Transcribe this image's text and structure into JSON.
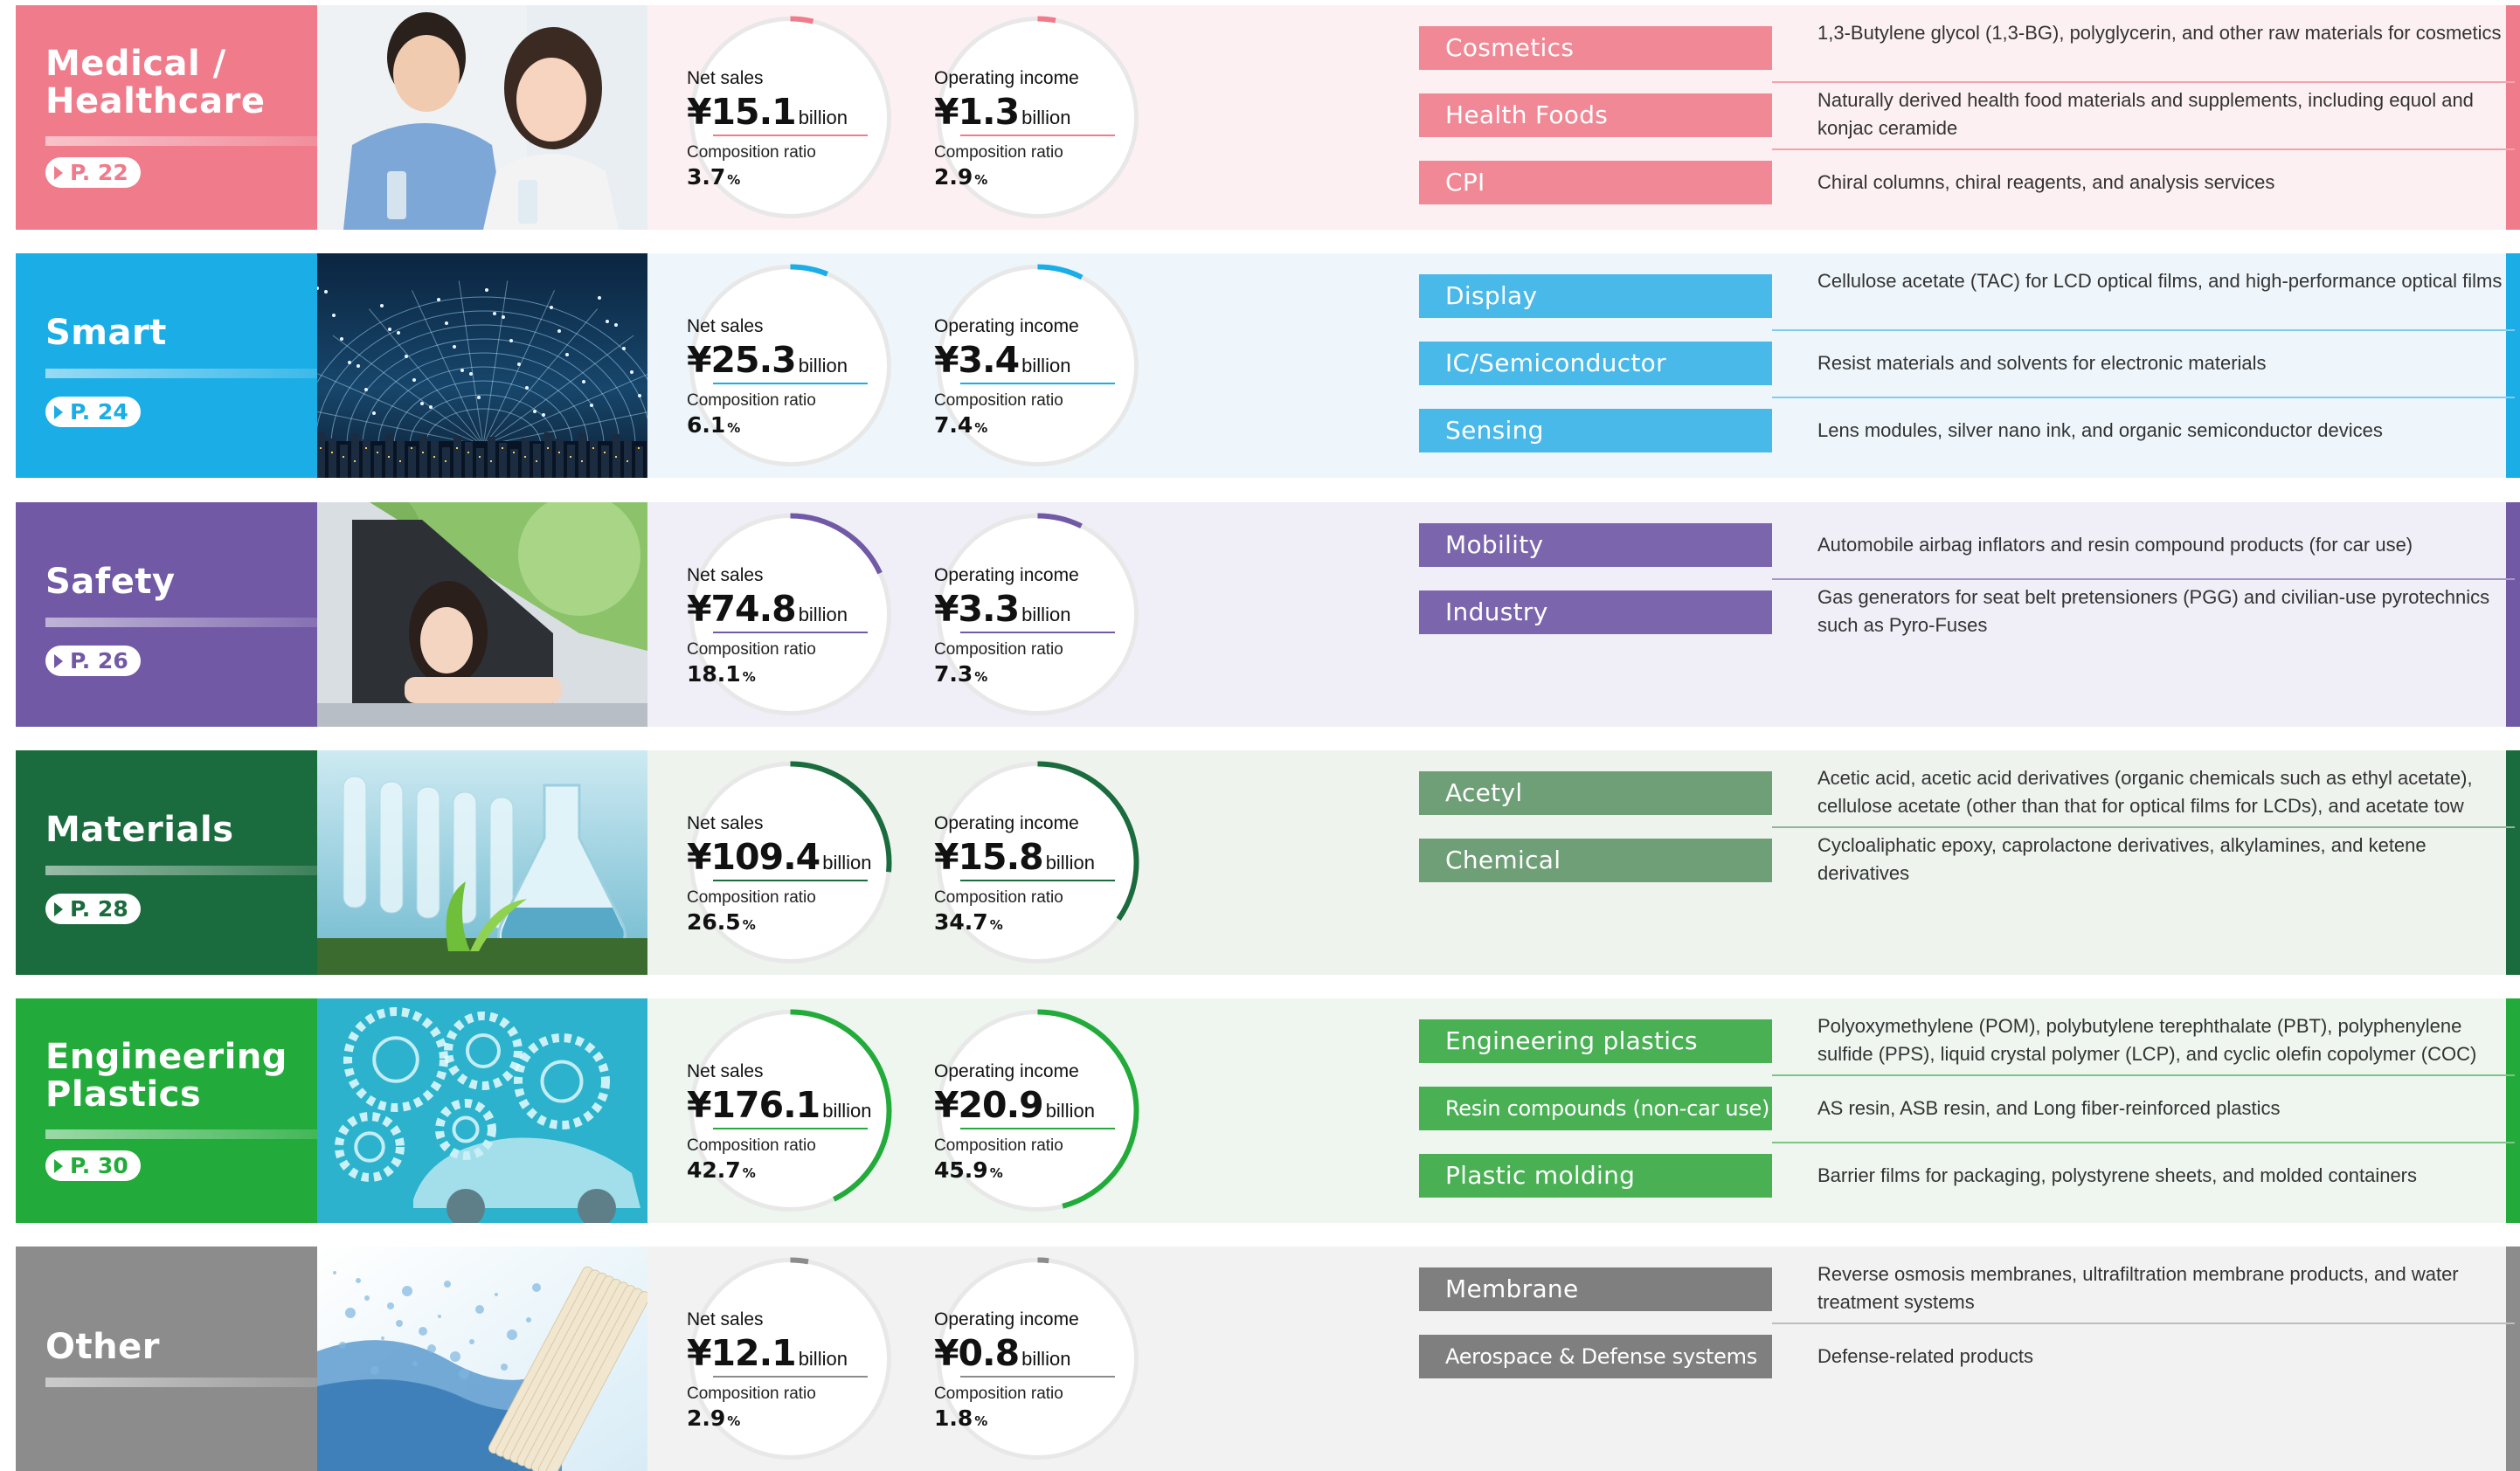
{
  "ring_labels": {
    "net_sales": "Net sales",
    "operating_income": "Operating income",
    "composition_ratio": "Composition ratio",
    "unit": "billion",
    "percent": "%"
  },
  "segments": [
    {
      "title": "Medical /\nHealthcare",
      "page": "P. 22",
      "color": "#ef7b8b",
      "panel_color": "#fdf0f2",
      "biz_color": "#f08895",
      "line_color": "#f2a3ad",
      "photo": "couple-icon",
      "net_sales": "¥15.1",
      "net_sales_ratio": "3.7",
      "net_sales_share": 0.037,
      "operating_income": "¥1.3",
      "operating_income_ratio": "2.9",
      "operating_income_share": 0.029,
      "businesses": [
        {
          "name": "Cosmetics",
          "desc": "1,3-Butylene glycol (1,3-BG), polyglycerin, and other raw materials for cosmetics"
        },
        {
          "name": "Health Foods",
          "desc": "Naturally derived health food materials and supplements, including equol and konjac ceramide"
        },
        {
          "name": "CPI",
          "desc": "Chiral columns, chiral reagents, and analysis services"
        }
      ]
    },
    {
      "title": "Smart",
      "page": "P. 24",
      "color": "#1aade6",
      "panel_color": "#eef6fb",
      "biz_color": "#49b9ea",
      "line_color": "#7fcdee",
      "photo": "network-globe-icon",
      "net_sales": "¥25.3",
      "net_sales_ratio": "6.1",
      "net_sales_share": 0.061,
      "operating_income": "¥3.4",
      "operating_income_ratio": "7.4",
      "operating_income_share": 0.074,
      "businesses": [
        {
          "name": "Display",
          "desc": "Cellulose acetate (TAC) for LCD optical films, and high-performance optical films"
        },
        {
          "name": "IC/Semiconductor",
          "desc": "Resist materials and solvents for electronic materials"
        },
        {
          "name": "Sensing",
          "desc": "Lens modules, silver nano ink, and organic semiconductor devices"
        }
      ]
    },
    {
      "title": "Safety",
      "page": "P. 26",
      "color": "#7159a6",
      "panel_color": "#f0eef7",
      "biz_color": "#7b66ad",
      "line_color": "#a797c8",
      "photo": "car-driver-icon",
      "net_sales": "¥74.8",
      "net_sales_ratio": "18.1",
      "net_sales_share": 0.181,
      "operating_income": "¥3.3",
      "operating_income_ratio": "7.3",
      "operating_income_share": 0.073,
      "businesses": [
        {
          "name": "Mobility",
          "desc": "Automobile airbag inflators and resin compound products (for car use)"
        },
        {
          "name": "Industry",
          "desc": "Gas generators for seat belt pretensioners (PGG) and civilian-use pyrotechnics such as Pyro-Fuses"
        }
      ]
    },
    {
      "title": "Materials",
      "page": "P. 28",
      "color": "#1a6b3d",
      "panel_color": "#eef3ee",
      "biz_color": "#6f9f76",
      "line_color": "#8fb795",
      "photo": "lab-flask-icon",
      "net_sales": "¥109.4",
      "net_sales_ratio": "26.5",
      "net_sales_share": 0.265,
      "operating_income": "¥15.8",
      "operating_income_ratio": "34.7",
      "operating_income_share": 0.347,
      "businesses": [
        {
          "name": "Acetyl",
          "desc": "Acetic acid, acetic acid derivatives (organic chemicals such as ethyl acetate), cellulose acetate (other than that for optical films for LCDs), and acetate tow"
        },
        {
          "name": "Chemical",
          "desc": "Cycloaliphatic epoxy, caprolactone derivatives, alkylamines, and ketene derivatives"
        }
      ]
    },
    {
      "title": "Engineering\nPlastics",
      "page": "P. 30",
      "color": "#22ab3a",
      "panel_color": "#eef6ef",
      "biz_color": "#49b054",
      "line_color": "#7cc585",
      "photo": "gears-car-icon",
      "net_sales": "¥176.1",
      "net_sales_ratio": "42.7",
      "net_sales_share": 0.427,
      "operating_income": "¥20.9",
      "operating_income_ratio": "45.9",
      "operating_income_share": 0.459,
      "businesses": [
        {
          "name": "Engineering plastics",
          "desc": "Polyoxymethylene (POM), polybutylene terephthalate (PBT), polyphenylene sulfide (PPS), liquid crystal polymer (LCP), and cyclic olefin copolymer (COC)"
        },
        {
          "name": "Resin compounds (non-car use)",
          "desc": "AS resin, ASB resin, and Long fiber-reinforced plastics"
        },
        {
          "name": "Plastic molding",
          "desc": "Barrier films for packaging, polystyrene sheets, and molded containers"
        }
      ]
    },
    {
      "title": "Other",
      "page": "",
      "color": "#8c8c8c",
      "panel_color": "#f2f2f2",
      "biz_color": "#7f7f7f",
      "line_color": "#bdbdbd",
      "photo": "water-membrane-icon",
      "net_sales": "¥12.1",
      "net_sales_ratio": "2.9",
      "net_sales_share": 0.029,
      "operating_income": "¥0.8",
      "operating_income_ratio": "1.8",
      "operating_income_share": 0.018,
      "businesses": [
        {
          "name": "Membrane",
          "desc": "Reverse osmosis membranes, ultrafiltration membrane products, and water treatment systems"
        },
        {
          "name": "Aerospace & Defense systems",
          "desc": "Defense-related products"
        }
      ]
    }
  ]
}
